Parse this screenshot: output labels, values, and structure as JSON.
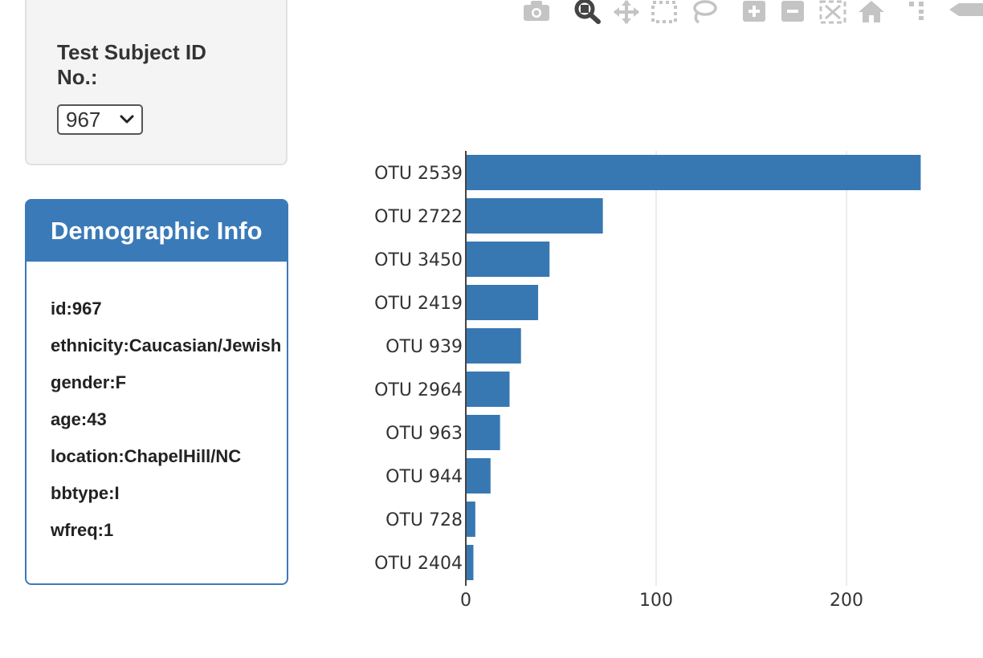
{
  "selector": {
    "label": "Test Subject ID No.:",
    "selected": "967"
  },
  "demographic": {
    "title": "Demographic Info",
    "rows": [
      "id:967",
      "ethnicity:Caucasian/Jewish",
      "gender:F",
      "age:43",
      "location:ChapelHill/NC",
      "bbtype:I",
      "wfreq:1"
    ]
  },
  "toolbar": {
    "icons": [
      "camera-icon",
      "zoom-icon",
      "pan-icon",
      "box-select-icon",
      "lasso-icon",
      "zoom-in-icon",
      "zoom-out-icon",
      "autoscale-icon",
      "reset-axes-icon",
      "spike-lines-icon",
      "compare-hover-icon"
    ]
  },
  "colors": {
    "bar": "#3878b2",
    "panel": "#3a7ab8"
  },
  "chart_data": {
    "type": "bar",
    "orientation": "horizontal",
    "categories": [
      "OTU 2539",
      "OTU 2722",
      "OTU 3450",
      "OTU 2419",
      "OTU 939",
      "OTU 2964",
      "OTU 963",
      "OTU 944",
      "OTU 728",
      "OTU 2404"
    ],
    "values": [
      239,
      72,
      44,
      38,
      29,
      23,
      18,
      13,
      5,
      4
    ],
    "xlim": [
      0,
      250
    ],
    "xticks": [
      0,
      100,
      200
    ],
    "grid": true,
    "title": "",
    "xlabel": "",
    "ylabel": ""
  }
}
